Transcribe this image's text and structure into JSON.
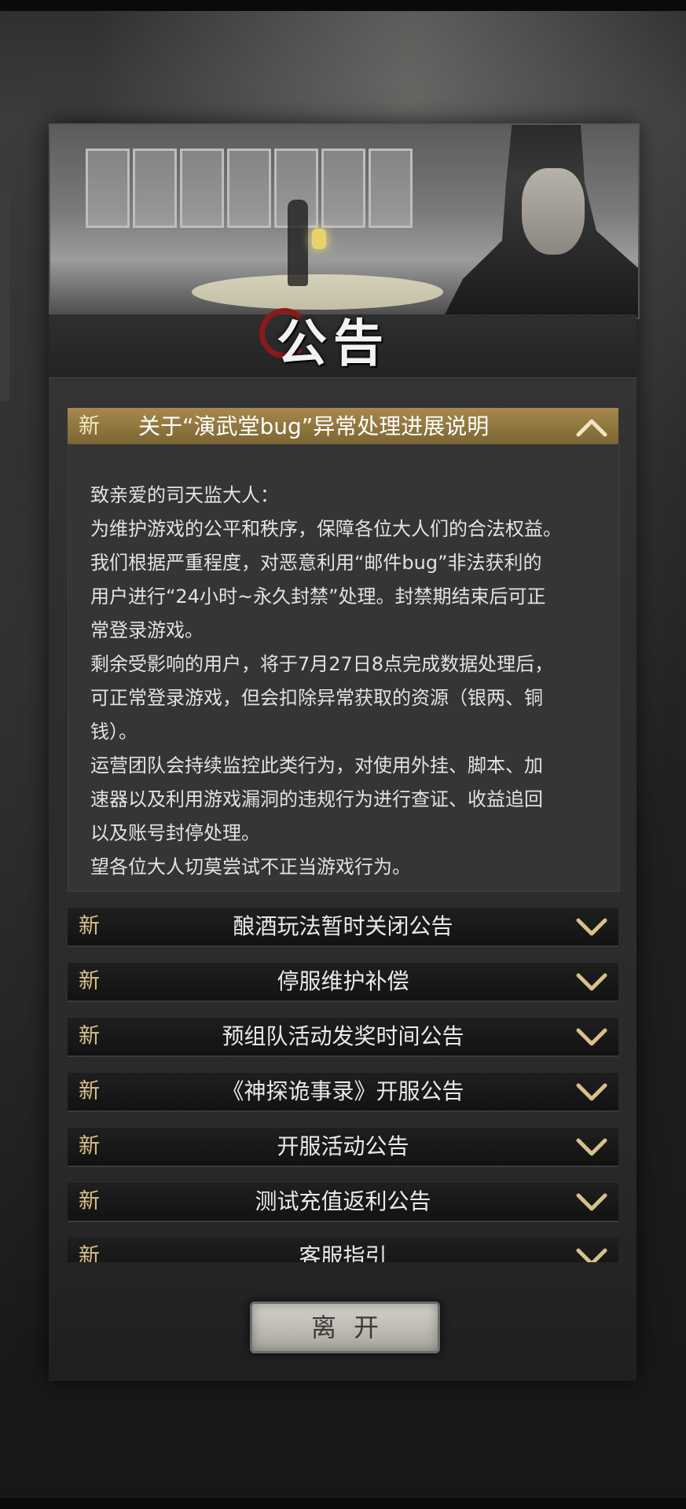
{
  "header": {
    "title": "公告"
  },
  "open_item": {
    "new_tag": "新",
    "title": "关于“演武堂bug”异常处理进展说明",
    "content_lines": [
      "致亲爱的司天监大人：",
      "为维护游戏的公平和秩序，保障各位大人们的合法权益。",
      "我们根据严重程度，对恶意利用“邮件bug”非法获利的",
      "用户进行“24小时~永久封禁”处理。封禁期结束后可正",
      "常登录游戏。",
      "剩余受影响的用户，将于7月27日8点完成数据处理后，",
      "可正常登录游戏，但会扣除异常获取的资源（银两、铜",
      "钱）。",
      "运营团队会持续监控此类行为，对使用外挂、脚本、加",
      "速器以及利用游戏漏洞的违规行为进行查证、收益追回",
      "以及账号封停处理。",
      "望各位大人切莫尝试不正当游戏行为。"
    ]
  },
  "items": [
    {
      "new_tag": "新",
      "title": "酿酒玩法暂时关闭公告"
    },
    {
      "new_tag": "新",
      "title": "停服维护补偿"
    },
    {
      "new_tag": "新",
      "title": "预组队活动发奖时间公告"
    },
    {
      "new_tag": "新",
      "title": "《神探诡事录》开服公告"
    },
    {
      "new_tag": "新",
      "title": "开服活动公告"
    },
    {
      "new_tag": "新",
      "title": "测试充值返利公告"
    },
    {
      "new_tag": "新",
      "title": "客服指引"
    }
  ],
  "leave_button": {
    "label": "离开"
  },
  "icons": {
    "expanded": "chevron-up-icon",
    "collapsed": "chevron-down-icon"
  },
  "colors": {
    "accent_gold": "#a6894b",
    "new_tag": "#d9c089",
    "chevron": "#d8c08a"
  }
}
